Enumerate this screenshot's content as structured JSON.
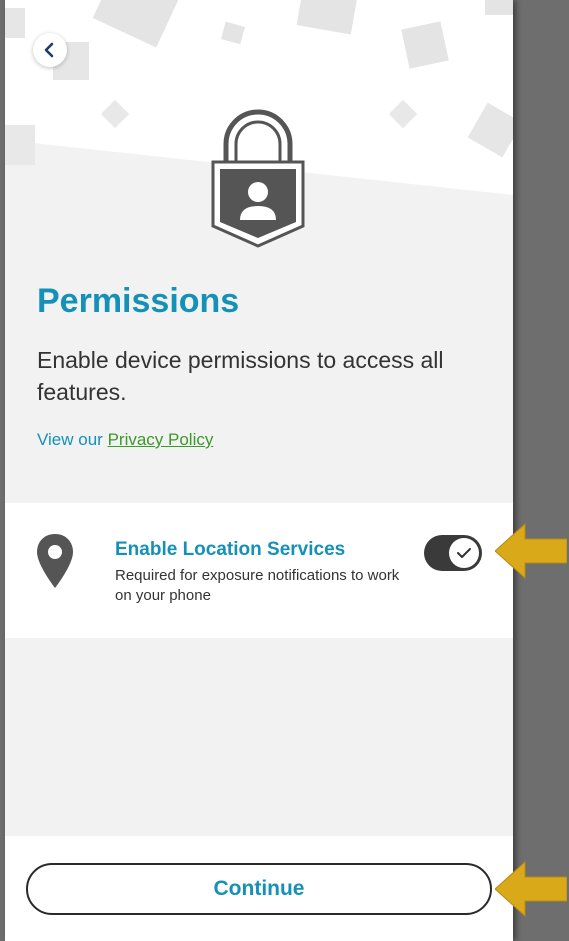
{
  "screen": {
    "title": "Permissions",
    "subtitle": "Enable device permissions to access all features.",
    "privacy_prefix": "View our ",
    "privacy_link": "Privacy Policy"
  },
  "back_button": {
    "icon": "chevron-left-icon"
  },
  "hero": {
    "icon": "lock-user-icon"
  },
  "permissions": [
    {
      "icon": "location-pin-icon",
      "title": "Enable Location Services",
      "description": "Required for exposure notifications to work on your phone",
      "enabled": true
    }
  ],
  "continue_button": {
    "label": "Continue"
  },
  "annotations": {
    "arrow_icon": "arrow-left-icon",
    "arrow_color": "#d9a91a"
  },
  "colors": {
    "accent": "#1591b8",
    "link": "#3a9a2a",
    "toggle_on": "#3a3a3a"
  }
}
